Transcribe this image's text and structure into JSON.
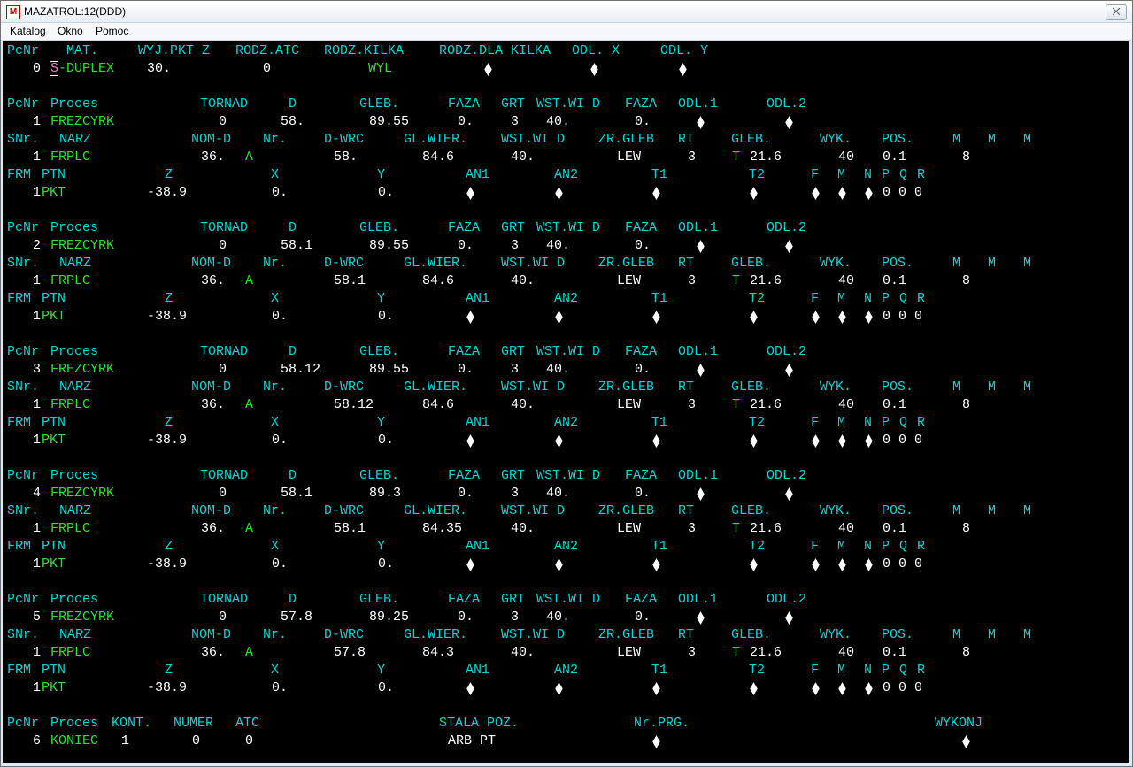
{
  "window": {
    "title": "MAZATROL:12(DDD)",
    "app_icon": "M",
    "close_symbol": "⨉"
  },
  "menu": [
    "Katalog",
    "Okno",
    "Pomoc"
  ],
  "colors": {
    "header": "#00d8d8",
    "value": "#ffffff",
    "green": "#2ee02e",
    "background": "#000000"
  },
  "header_block": {
    "cols": [
      "PcNr",
      "MAT.",
      "WYJ.PKT Z",
      "RODZ.ATC",
      "RODZ.KILKA",
      "RODZ.DLA KILKA",
      "ODL. X",
      "ODL. Y"
    ],
    "pcnr": "0",
    "mat_first": "S",
    "mat_rest": "-DUPLEX",
    "wyj_pkt_z": "30.",
    "rodz_atc": "0",
    "rodz_kilka": "WYL"
  },
  "labels": {
    "proc": [
      "PcNr",
      "Proces",
      "TORNAD",
      "D",
      "GLEB.",
      "FAZA",
      "GRT",
      "WST.WI D",
      "FAZA",
      "ODL.1",
      "ODL.2"
    ],
    "tool": [
      "SNr.",
      "NARZ",
      "NOM-D",
      "Nr.",
      "D-WRC",
      "GL.WIER.",
      "WST.WI D",
      "ZR.GLEB",
      "RT",
      "GLEB.",
      "WYK.",
      "POS.",
      "M",
      "M",
      "M"
    ],
    "frm": [
      "FRM",
      "PTN",
      "Z",
      "X",
      "Y",
      "AN1",
      "AN2",
      "T1",
      "T2",
      "F",
      "M",
      "N",
      "P",
      "Q",
      "R"
    ],
    "end": [
      "PcNr",
      "Proces",
      "KONT.",
      "NUMER",
      "ATC",
      "STALA POZ.",
      "Nr.PRG.",
      "WYKONJ"
    ]
  },
  "units": [
    {
      "pcnr": "1",
      "proces": "FREZCYRK",
      "tornad": "0",
      "d": "58.",
      "gleb": "89.55",
      "faza": "0.",
      "grt": "3",
      "wst": "40.",
      "faza2": "0.",
      "tool": {
        "snr": "1",
        "narz": "FRPLC",
        "nomd": "36.",
        "nr": "A",
        "dwrc": "58.",
        "glwier": "84.6",
        "wst": "40.",
        "zrgleb": "LEW",
        "rt": "3",
        "gleb_prefix": "T",
        "gleb": "21.6",
        "wyk": "40",
        "pos": "0.1",
        "m": "8"
      },
      "frm": {
        "frm": "1",
        "ptn": "PKT",
        "z": "-38.9",
        "x": "0.",
        "y": "0.",
        "pqr": "0 0 0"
      }
    },
    {
      "pcnr": "2",
      "proces": "FREZCYRK",
      "tornad": "0",
      "d": "58.1",
      "gleb": "89.55",
      "faza": "0.",
      "grt": "3",
      "wst": "40.",
      "faza2": "0.",
      "tool": {
        "snr": "1",
        "narz": "FRPLC",
        "nomd": "36.",
        "nr": "A",
        "dwrc": "58.1",
        "glwier": "84.6",
        "wst": "40.",
        "zrgleb": "LEW",
        "rt": "3",
        "gleb_prefix": "T",
        "gleb": "21.6",
        "wyk": "40",
        "pos": "0.1",
        "m": "8"
      },
      "frm": {
        "frm": "1",
        "ptn": "PKT",
        "z": "-38.9",
        "x": "0.",
        "y": "0.",
        "pqr": "0 0 0"
      }
    },
    {
      "pcnr": "3",
      "proces": "FREZCYRK",
      "tornad": "0",
      "d": "58.12",
      "gleb": "89.55",
      "faza": "0.",
      "grt": "3",
      "wst": "40.",
      "faza2": "0.",
      "tool": {
        "snr": "1",
        "narz": "FRPLC",
        "nomd": "36.",
        "nr": "A",
        "dwrc": "58.12",
        "glwier": "84.6",
        "wst": "40.",
        "zrgleb": "LEW",
        "rt": "3",
        "gleb_prefix": "T",
        "gleb": "21.6",
        "wyk": "40",
        "pos": "0.1",
        "m": "8"
      },
      "frm": {
        "frm": "1",
        "ptn": "PKT",
        "z": "-38.9",
        "x": "0.",
        "y": "0.",
        "pqr": "0 0 0"
      }
    },
    {
      "pcnr": "4",
      "proces": "FREZCYRK",
      "tornad": "0",
      "d": "58.1",
      "gleb": "89.3",
      "faza": "0.",
      "grt": "3",
      "wst": "40.",
      "faza2": "0.",
      "tool": {
        "snr": "1",
        "narz": "FRPLC",
        "nomd": "36.",
        "nr": "A",
        "dwrc": "58.1",
        "glwier": "84.35",
        "wst": "40.",
        "zrgleb": "LEW",
        "rt": "3",
        "gleb_prefix": "T",
        "gleb": "21.6",
        "wyk": "40",
        "pos": "0.1",
        "m": "8"
      },
      "frm": {
        "frm": "1",
        "ptn": "PKT",
        "z": "-38.9",
        "x": "0.",
        "y": "0.",
        "pqr": "0 0 0"
      }
    },
    {
      "pcnr": "5",
      "proces": "FREZCYRK",
      "tornad": "0",
      "d": "57.8",
      "gleb": "89.25",
      "faza": "0.",
      "grt": "3",
      "wst": "40.",
      "faza2": "0.",
      "tool": {
        "snr": "1",
        "narz": "FRPLC",
        "nomd": "36.",
        "nr": "A",
        "dwrc": "57.8",
        "glwier": "84.3",
        "wst": "40.",
        "zrgleb": "LEW",
        "rt": "3",
        "gleb_prefix": "T",
        "gleb": "21.6",
        "wyk": "40",
        "pos": "0.1",
        "m": "8"
      },
      "frm": {
        "frm": "1",
        "ptn": "PKT",
        "z": "-38.9",
        "x": "0.",
        "y": "0.",
        "pqr": "0 0 0"
      }
    }
  ],
  "end_unit": {
    "pcnr": "6",
    "proces": "KONIEC",
    "kont": "1",
    "numer": "0",
    "atc": "0",
    "stala_poz": "ARB PT"
  }
}
